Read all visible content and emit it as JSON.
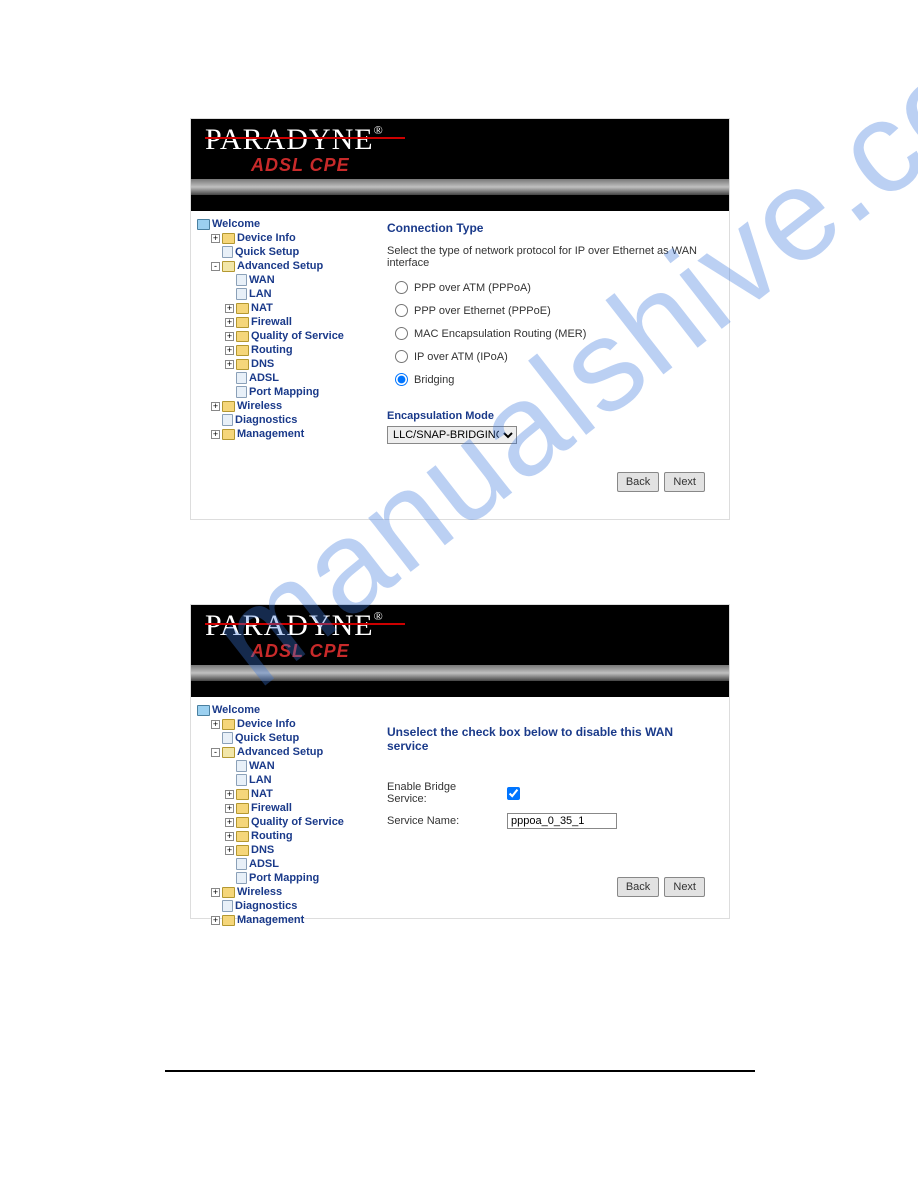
{
  "watermark": "manualshive.com",
  "brand": {
    "name": "PARADYNE",
    "reg": "®",
    "sub": "ADSL CPE"
  },
  "tree1": {
    "root": "Welcome",
    "items": [
      {
        "exp": "+",
        "ico": "folder",
        "label": "Device Info"
      },
      {
        "exp": "",
        "ico": "page",
        "label": "Quick Setup"
      },
      {
        "exp": "-",
        "ico": "open",
        "label": "Advanced Setup",
        "children": [
          {
            "exp": "",
            "ico": "page",
            "label": "WAN"
          },
          {
            "exp": "",
            "ico": "page",
            "label": "LAN"
          },
          {
            "exp": "+",
            "ico": "folder",
            "label": "NAT"
          },
          {
            "exp": "+",
            "ico": "folder",
            "label": "Firewall"
          },
          {
            "exp": "+",
            "ico": "folder",
            "label": "Quality of Service"
          },
          {
            "exp": "+",
            "ico": "folder",
            "label": "Routing"
          },
          {
            "exp": "+",
            "ico": "folder",
            "label": "DNS"
          },
          {
            "exp": "",
            "ico": "page",
            "label": "ADSL"
          },
          {
            "exp": "",
            "ico": "page",
            "label": "Port Mapping"
          }
        ]
      },
      {
        "exp": "+",
        "ico": "folder",
        "label": "Wireless"
      },
      {
        "exp": "",
        "ico": "page",
        "label": "Diagnostics"
      },
      {
        "exp": "+",
        "ico": "folder",
        "label": "Management"
      }
    ]
  },
  "tree2": {
    "root": "Welcome",
    "items": [
      {
        "exp": "+",
        "ico": "folder",
        "label": "Device Info"
      },
      {
        "exp": "",
        "ico": "page",
        "label": "Quick Setup"
      },
      {
        "exp": "-",
        "ico": "open",
        "label": "Advanced Setup",
        "children": [
          {
            "exp": "",
            "ico": "page",
            "label": "WAN"
          },
          {
            "exp": "",
            "ico": "page",
            "label": "LAN"
          },
          {
            "exp": "+",
            "ico": "folder",
            "label": "NAT"
          },
          {
            "exp": "+",
            "ico": "folder",
            "label": "Firewall"
          },
          {
            "exp": "+",
            "ico": "folder",
            "label": "Quality of Service"
          },
          {
            "exp": "+",
            "ico": "folder",
            "label": "Routing"
          },
          {
            "exp": "+",
            "ico": "folder",
            "label": "DNS"
          },
          {
            "exp": "",
            "ico": "page",
            "label": "ADSL"
          },
          {
            "exp": "",
            "ico": "page",
            "label": "Port Mapping"
          }
        ]
      },
      {
        "exp": "+",
        "ico": "folder",
        "label": "Wireless"
      },
      {
        "exp": "",
        "ico": "page",
        "label": "Diagnostics"
      },
      {
        "exp": "+",
        "ico": "folder",
        "label": "Management"
      }
    ]
  },
  "pane1": {
    "heading": "Connection Type",
    "desc": "Select the type of network protocol for IP over Ethernet as WAN interface",
    "radios": [
      "PPP over ATM (PPPoA)",
      "PPP over Ethernet (PPPoE)",
      "MAC Encapsulation Routing (MER)",
      "IP over ATM (IPoA)",
      "Bridging"
    ],
    "selected": 4,
    "encap_label": "Encapsulation Mode",
    "encap_value": "LLC/SNAP-BRIDGING",
    "back": "Back",
    "next": "Next"
  },
  "pane2": {
    "heading": "Unselect the check box below to disable this WAN service",
    "enable_label": "Enable Bridge Service:",
    "enable_checked": true,
    "svc_label": "Service Name:",
    "svc_value": "pppoa_0_35_1",
    "back": "Back",
    "next": "Next"
  }
}
